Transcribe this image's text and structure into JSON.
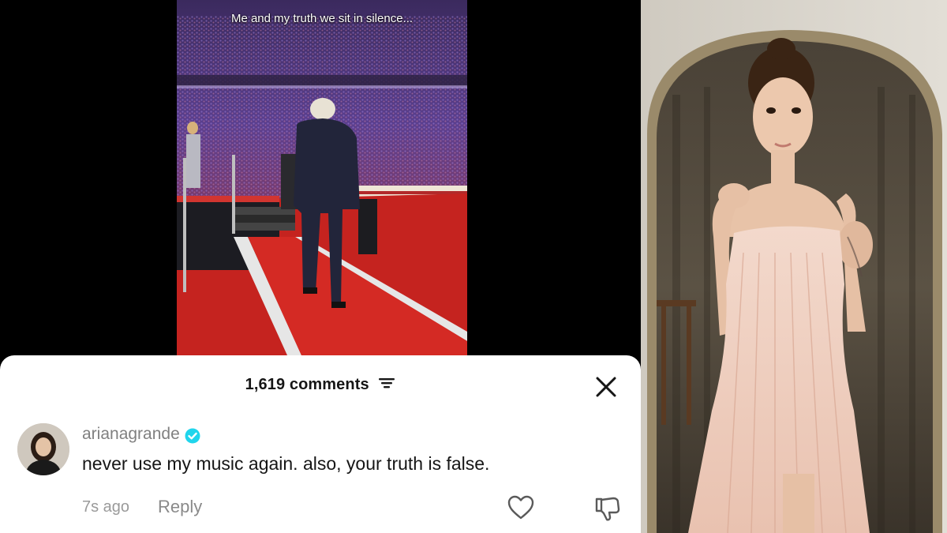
{
  "video": {
    "caption": "Me and my truth we sit in silence..."
  },
  "comments": {
    "count_label": "1,619 comments",
    "filter_icon": "filter-icon",
    "close_icon": "close-icon",
    "items": [
      {
        "username": "arianagrande",
        "verified": true,
        "text": "never use my music again. also, your truth is false.",
        "time": "7s ago",
        "reply_label": "Reply"
      }
    ]
  },
  "colors": {
    "verified_badge": "#20d5ec",
    "stage_red": "#d42a24",
    "sheet_bg": "#ffffff",
    "photo_bg": "#d8d4cc"
  }
}
